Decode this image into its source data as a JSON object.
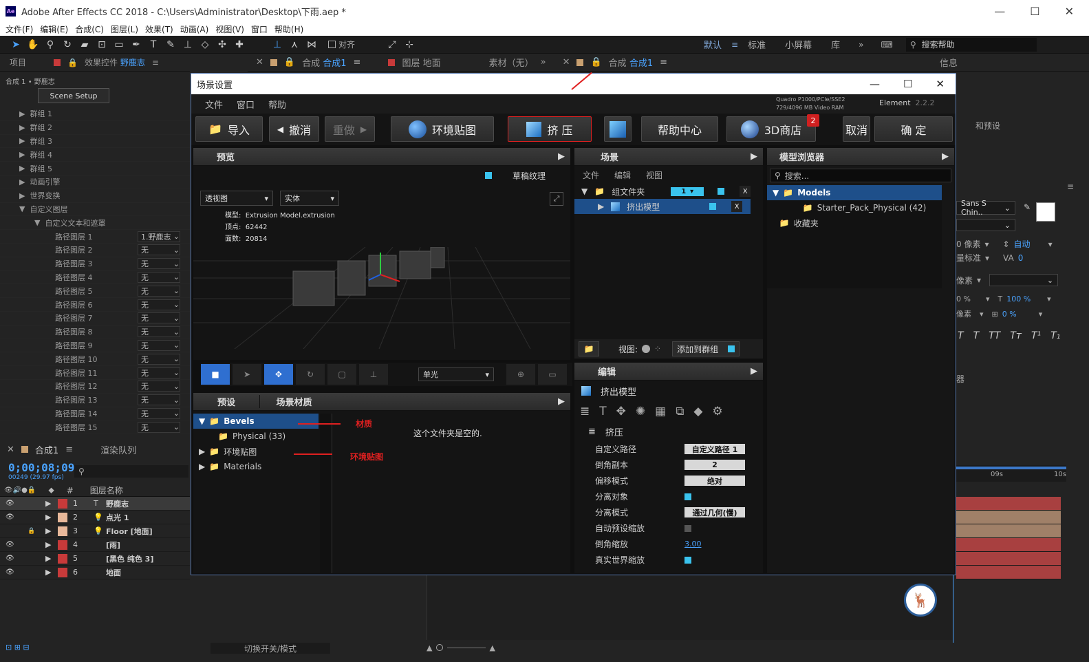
{
  "window": {
    "title": "Adobe After Effects CC 2018 - C:\\Users\\Administrator\\Desktop\\下雨.aep *",
    "app_icon": "Ae"
  },
  "menu": [
    "文件(F)",
    "编辑(E)",
    "合成(C)",
    "图层(L)",
    "效果(T)",
    "动画(A)",
    "视图(V)",
    "窗口",
    "帮助(H)"
  ],
  "toolbar": {
    "align_label": "对齐",
    "workspaces": [
      "默认",
      "标准",
      "小屏幕",
      "库"
    ],
    "search_placeholder": "搜索帮助"
  },
  "panels": {
    "project_tab": "项目",
    "effects_tab": "效果控件",
    "effects_layer": "野鹿志",
    "breadcrumb": "合成 1 • 野鹿志",
    "comp_tab_prefix": "合成",
    "comp_tab_name": "合成1",
    "layer_tab": "图层 地面",
    "footage_tab": "素材（无）",
    "info_tab": "信息"
  },
  "effects": {
    "scene_setup": "Scene Setup",
    "groups": [
      "群组 1",
      "群组 2",
      "群组 3",
      "群组 4",
      "群组 5",
      "动画引擎",
      "世界变换",
      "自定义图层"
    ],
    "sub_group": "自定义文本和遮罩",
    "path_layers": [
      {
        "label": "路径图层 1",
        "value": "1.野鹿志"
      },
      {
        "label": "路径图层 2",
        "value": "无"
      },
      {
        "label": "路径图层 3",
        "value": "无"
      },
      {
        "label": "路径图层 4",
        "value": "无"
      },
      {
        "label": "路径图层 5",
        "value": "无"
      },
      {
        "label": "路径图层 6",
        "value": "无"
      },
      {
        "label": "路径图层 7",
        "value": "无"
      },
      {
        "label": "路径图层 8",
        "value": "无"
      },
      {
        "label": "路径图层 9",
        "value": "无"
      },
      {
        "label": "路径图层 10",
        "value": "无"
      },
      {
        "label": "路径图层 11",
        "value": "无"
      },
      {
        "label": "路径图层 12",
        "value": "无"
      },
      {
        "label": "路径图层 13",
        "value": "无"
      },
      {
        "label": "路径图层 14",
        "value": "无"
      },
      {
        "label": "路径图层 15",
        "value": "无"
      }
    ]
  },
  "timeline": {
    "tab": "合成1",
    "render_queue": "渲染队列",
    "timecode": "0;00;08;09",
    "frames": "00249 (29.97 fps)",
    "col_name": "图层名称",
    "col_num": "#",
    "layers": [
      {
        "num": "1",
        "type": "T",
        "name": "野鹿志",
        "color": "#c83a3a"
      },
      {
        "num": "2",
        "type": "💡",
        "name": "点光 1",
        "color": "#e8b89a"
      },
      {
        "num": "3",
        "type": "💡",
        "name": "Floor [地面]",
        "color": "#e8b89a"
      },
      {
        "num": "4",
        "type": "",
        "name": "[雨]",
        "color": "#c83a3a"
      },
      {
        "num": "5",
        "type": "",
        "name": "[黑色 纯色 3]",
        "color": "#c83a3a"
      },
      {
        "num": "6",
        "type": "",
        "name": "地面",
        "color": "#c83a3a"
      }
    ],
    "switch_mode": "切换开关/模式",
    "ruler": [
      "09s",
      "10s"
    ]
  },
  "dialog": {
    "title": "场景设置",
    "menu": [
      "文件",
      "窗口",
      "帮助"
    ],
    "gpu": "Quadro P1000/PCIe/SSE2",
    "vram": "729/4096 MB Video RAM",
    "product": "Element",
    "version": "2.2.2",
    "buttons": {
      "import": "导入",
      "undo": "撤消",
      "redo": "重做",
      "env": "环境贴图",
      "extrude": "挤 压",
      "help": "帮助中心",
      "store": "3D商店",
      "store_badge": "2",
      "cancel": "取消",
      "ok": "确 定"
    },
    "preview": {
      "head": "预览",
      "draft_texture": "草稿纹理",
      "view_mode": "透视图",
      "shade_mode": "实体",
      "model_label": "模型:",
      "model_value": "Extrusion Model.extrusion",
      "verts_label": "顶点:",
      "verts_value": "62442",
      "faces_label": "面数:",
      "faces_value": "20814",
      "light_mode": "单光"
    },
    "presets": {
      "tab1": "预设",
      "tab2": "场景材质",
      "tree": [
        {
          "label": "Bevels",
          "level": 0,
          "open": true,
          "selected": true
        },
        {
          "label": "Physical (33)",
          "level": 1
        },
        {
          "label": "环境贴图",
          "level": 0
        },
        {
          "label": "Materials",
          "level": 0
        }
      ],
      "empty_msg": "这个文件夹是空的.",
      "note_material": "材质",
      "note_env": "环境贴图"
    },
    "scene": {
      "head": "场景",
      "menu": [
        "文件",
        "编辑",
        "视图"
      ],
      "group_folder": "组文件夹",
      "group_num": "1",
      "extrude_model": "挤出模型",
      "view_label": "视图:",
      "add_group": "添加到群组"
    },
    "edit": {
      "head": "编辑",
      "title": "挤出模型",
      "section": "挤压",
      "props": [
        {
          "label": "自定义路径",
          "value": "自定义路径 1",
          "kind": "box"
        },
        {
          "label": "倒角副本",
          "value": "2",
          "kind": "box"
        },
        {
          "label": "偏移模式",
          "value": "绝对",
          "kind": "box"
        },
        {
          "label": "分离对象",
          "value": "",
          "kind": "check"
        },
        {
          "label": "分离模式",
          "value": "通过几何(慢)",
          "kind": "box"
        },
        {
          "label": "自动预设缩放",
          "value": "",
          "kind": "grey"
        },
        {
          "label": "倒角缩放",
          "value": "3.00",
          "kind": "link"
        },
        {
          "label": "真实世界缩放",
          "value": "",
          "kind": "check"
        }
      ]
    },
    "browser": {
      "head": "模型浏览器",
      "search_placeholder": "搜索...",
      "tree": [
        {
          "label": "Models",
          "level": 0,
          "selected": true
        },
        {
          "label": "Starter_Pack_Physical (42)",
          "level": 1
        },
        {
          "label": "收藏夹",
          "level": 0
        }
      ]
    }
  },
  "right_panel": {
    "presets_text": "和预设",
    "font": "Sans S Chin..",
    "px_label": "0 像素",
    "auto": "自动",
    "std": "量标准",
    "zero": "0",
    "px2": "像素",
    "pct100": "100 %",
    "pct0a": "0 %",
    "pct0b": "0 %",
    "pct0c": "0 %",
    "px3": "像素",
    "para": "器"
  }
}
